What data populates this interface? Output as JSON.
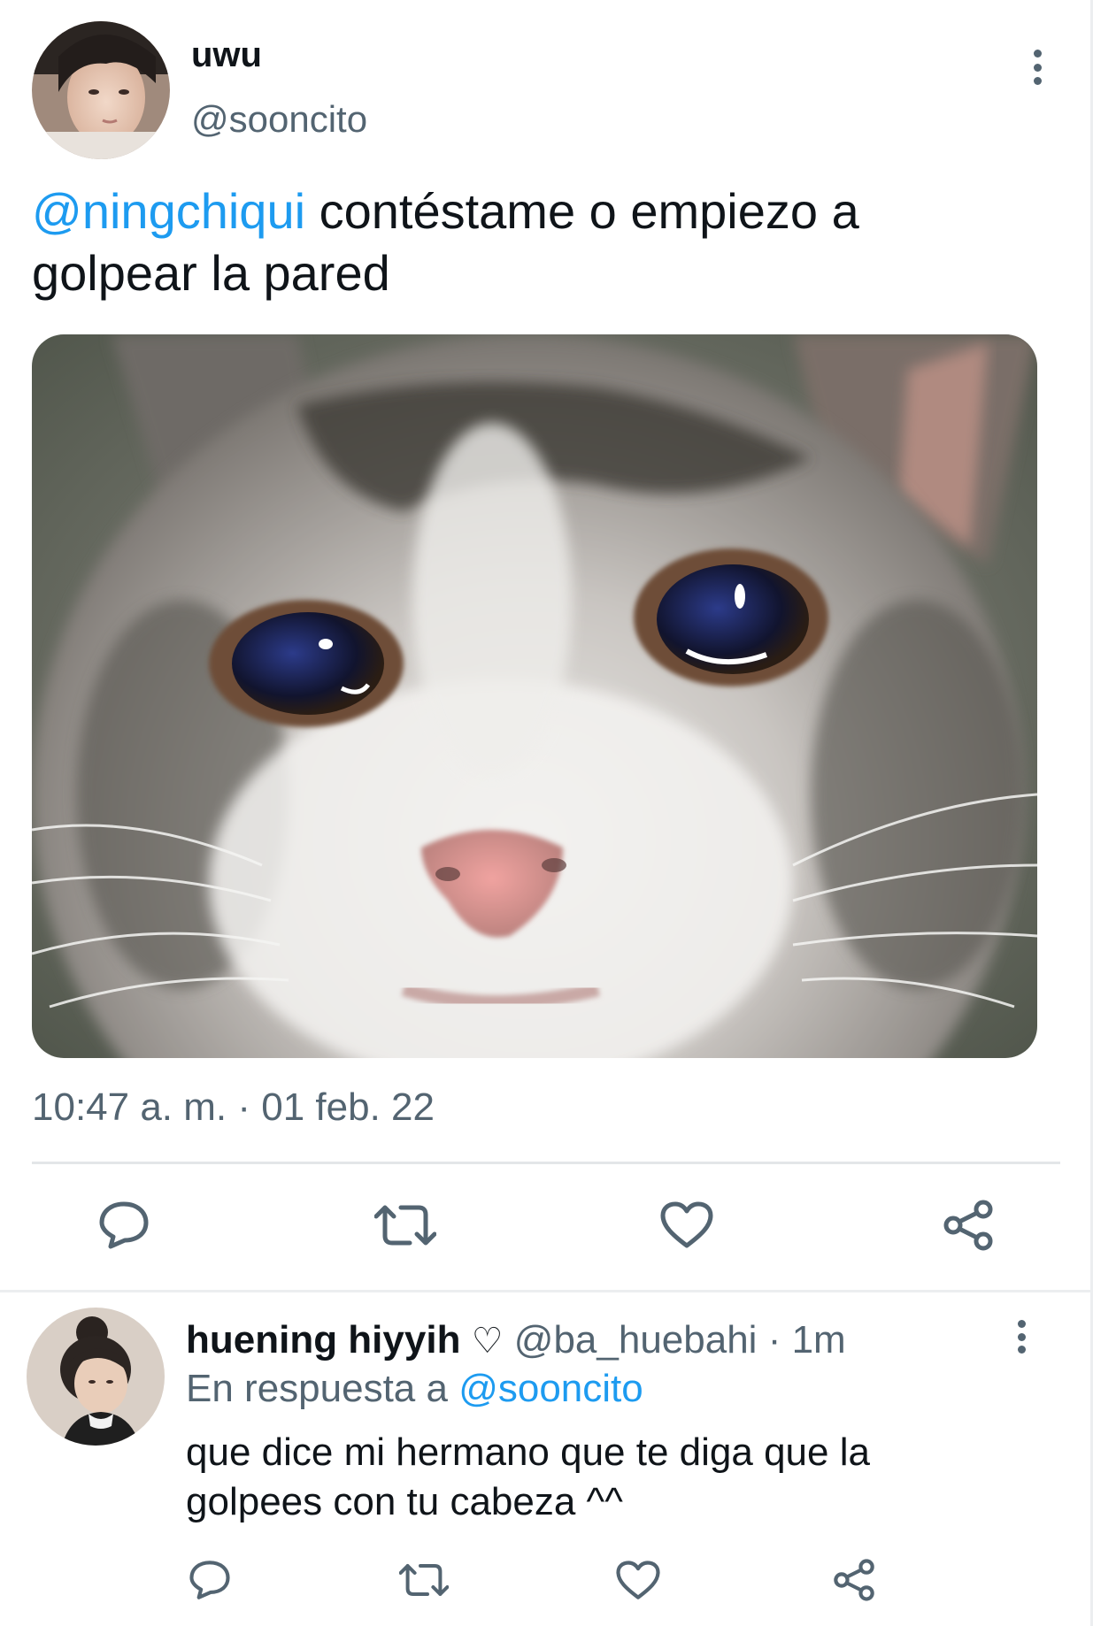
{
  "tweet": {
    "display_name": "uwu",
    "handle": "@sooncito",
    "mention": "@ningchiqui",
    "text_line1_rest": " contéstame o empiezo a",
    "text_line2": "golpear la pared",
    "timestamp": "10:47 a. m. · 01 feb. 22",
    "actions": [
      "reply-icon",
      "retweet-icon",
      "like-icon",
      "share-icon"
    ]
  },
  "reply": {
    "display_name": "huening hiyyih",
    "name_symbol": "♡",
    "handle": "@ba_huebahi",
    "time": "· 1m",
    "in_reply_prefix": "En respuesta a",
    "in_reply_handle": "@sooncito",
    "text_line1": "que dice mi hermano que te diga que la",
    "text_line2": "golpees con tu cabeza ^^",
    "actions": [
      "reply-icon",
      "retweet-icon",
      "like-icon",
      "share-icon"
    ]
  },
  "colors": {
    "text": "#0f1419",
    "muted": "#536471",
    "link": "#1d9bf0",
    "divider": "#e3e6e8"
  }
}
